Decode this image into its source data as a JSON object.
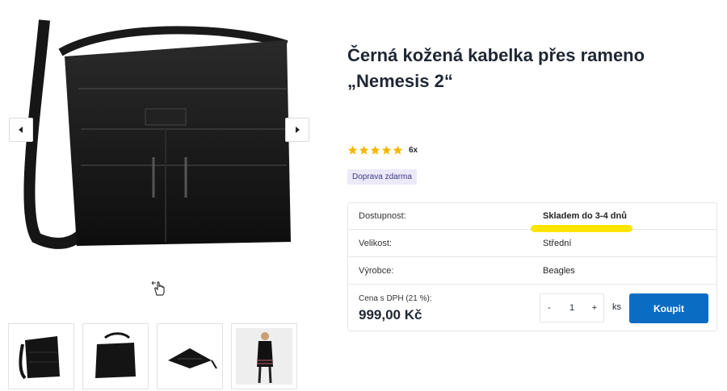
{
  "product": {
    "title_line1": "Černá kožená kabelka přes rameno",
    "title_line2": "„Nemesis 2“",
    "rating_count": "6x",
    "rating_stars": 5,
    "badge": "Doprava zdarma"
  },
  "details": {
    "availability_label": "Dostupnost:",
    "availability_value": "Skladem do 3-4 dnů",
    "size_label": "Velikost:",
    "size_value": "Střední",
    "maker_label": "Výrobce:",
    "maker_value": "Beagles"
  },
  "purchase": {
    "price_label": "Cena s DPH (21 %):",
    "price": "999,00 Kč",
    "minus": "-",
    "quantity": "1",
    "plus": "+",
    "unit": "ks",
    "buy_label": "Koupit"
  },
  "colors": {
    "accent": "#0a6cc2",
    "highlight": "#ffe600",
    "star": "#f5b800",
    "badge_bg": "#ece9f9"
  },
  "icons": {
    "prev": "chevron-left-icon",
    "next": "chevron-right-icon",
    "swipe": "swipe-hand-icon"
  }
}
